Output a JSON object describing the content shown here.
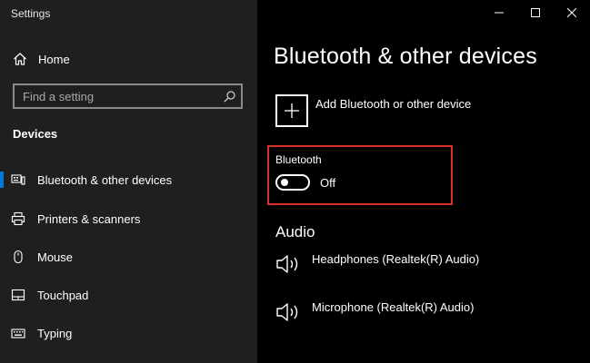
{
  "window": {
    "title": "Settings",
    "controls": {
      "minimize_icon": "minimize-icon",
      "maximize_icon": "maximize-icon",
      "close_icon": "close-icon"
    }
  },
  "sidebar": {
    "home": {
      "label": "Home",
      "icon": "home-icon"
    },
    "search": {
      "placeholder": "Find a setting",
      "value": "",
      "icon": "search-icon"
    },
    "section_title": "Devices",
    "items": [
      {
        "label": "Bluetooth & other devices",
        "icon": "bluetooth-devices-icon",
        "selected": true
      },
      {
        "label": "Printers & scanners",
        "icon": "printer-icon",
        "selected": false
      },
      {
        "label": "Mouse",
        "icon": "mouse-icon",
        "selected": false
      },
      {
        "label": "Touchpad",
        "icon": "touchpad-icon",
        "selected": false
      },
      {
        "label": "Typing",
        "icon": "keyboard-icon",
        "selected": false
      }
    ],
    "accent_color": "#0078d7"
  },
  "main": {
    "title": "Bluetooth & other devices",
    "add_device": {
      "label": "Add Bluetooth or other device",
      "icon": "plus-icon"
    },
    "bluetooth": {
      "label": "Bluetooth",
      "toggle_state": "Off",
      "on": false,
      "highlight_color": "#d9322c"
    },
    "audio": {
      "heading": "Audio",
      "devices": [
        {
          "label": "Headphones (Realtek(R) Audio)",
          "icon": "speaker-icon"
        },
        {
          "label": "Microphone (Realtek(R) Audio)",
          "icon": "speaker-icon"
        }
      ]
    }
  }
}
